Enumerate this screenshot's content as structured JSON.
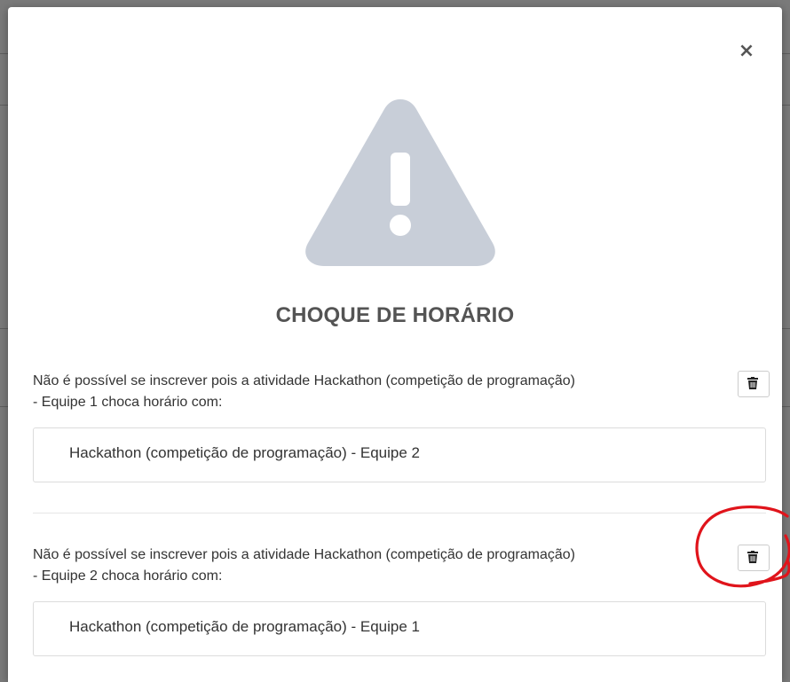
{
  "modal": {
    "close_symbol": "×",
    "title": "CHOQUE DE HORÁRIO",
    "icon": "warning-triangle-icon",
    "icon_color": "#c8ced8"
  },
  "conflicts": [
    {
      "message_line1": "Não é possível se inscrever pois a atividade Hackathon (competição de programação)",
      "message_line2": "- Equipe 1 choca horário com:",
      "item": "Hackathon (competição de programação) - Equipe 2",
      "delete_icon": "trash-icon"
    },
    {
      "message_line1": "Não é possível se inscrever pois a atividade Hackathon (competição de programação)",
      "message_line2": "- Equipe 2 choca horário com:",
      "item": "Hackathon (competição de programação) - Equipe 1",
      "delete_icon": "trash-icon"
    }
  ],
  "annotation": {
    "color": "#e0141b",
    "shape": "hand-drawn circle around second trash button"
  }
}
